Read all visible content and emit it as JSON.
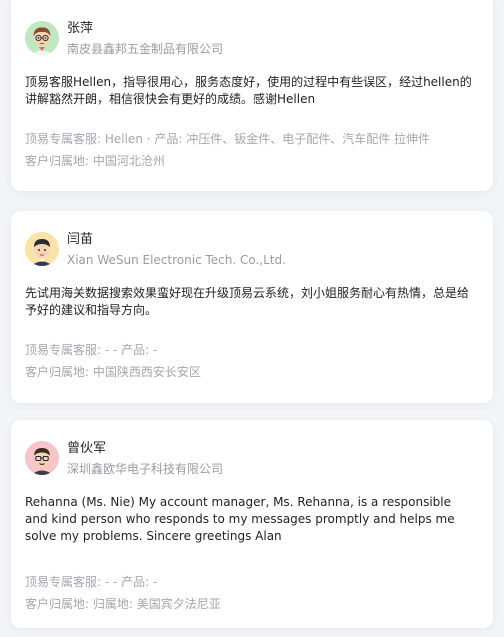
{
  "reviews": [
    {
      "name": "张萍",
      "company": "南皮县鑫邦五金制品有限公司",
      "content": "顶易客服Hellen，指导很用心，服务态度好，使用的过程中有些误区，经过hellen的讲解豁然开朗，相信很快会有更好的成绩。感谢Hellen",
      "service_line": "顶易专属客服: Hellen · 产品: 冲压件、钣金件、电子配件、汽车配件 拉伸件",
      "location_line": "客户归属地: 中国河北沧州",
      "avatar_icon": "avatar-man-brown-hair-glasses-icon",
      "avatar_bg": "#bfe7c1"
    },
    {
      "name": "闫苗",
      "company": "Xian WeSun Electronic Tech. Co.,Ltd.",
      "content": "先试用海关数据搜索效果蛮好现在升级顶易云系统，刘小姐服务耐心有热情，总是给予好的建议和指导方向。",
      "service_line": "顶易专属客服: - - 产品: -",
      "location_line": "客户归属地: 中国陕西西安长安区",
      "avatar_icon": "avatar-man-dark-hair-icon",
      "avatar_bg": "#fbe3a8"
    },
    {
      "name": "曾伙军",
      "company": "深圳鑫欧华电子科技有限公司",
      "content": "Rehanna (Ms. Nie) My account manager, Ms. Rehanna, is a responsible and kind person who responds to my messages promptly and helps me solve my problems. Sincere greetings Alan",
      "service_line": "顶易专属客服: - - 产品: -",
      "location_line": "客户归属地: 归属地:  美国宾夕法尼亚",
      "avatar_icon": "avatar-man-glasses-icon",
      "avatar_bg": "#f7c4c8"
    }
  ]
}
